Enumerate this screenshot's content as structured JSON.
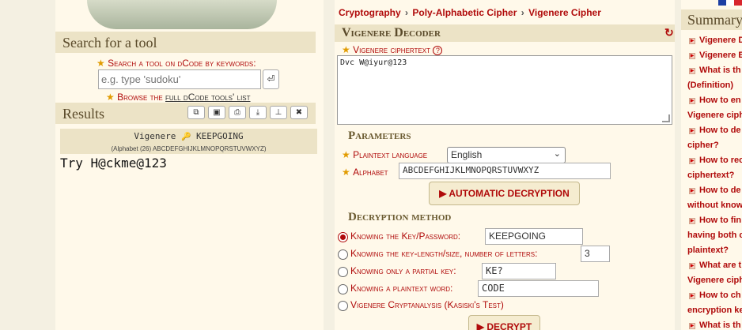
{
  "search": {
    "heading": "Search for a tool",
    "label": "Search a tool on dCode by keywords:",
    "placeholder": "e.g. type 'sudoku'",
    "go_symbol": "⏎",
    "browse_prefix": "Browse the ",
    "browse_link": "full dCode tools' list"
  },
  "results": {
    "heading": "Results",
    "icons": [
      "copy-icon",
      "screenshot-icon",
      "print-icon",
      "download-icon",
      "pin-icon",
      "close-icon"
    ],
    "cipher_name": "Vigenere",
    "key_symbol": "🔑",
    "key": "KEEPGOING",
    "alphabet_note": "(Alphabet (26) ABCDEFGHIJKLMNOPQRSTUVWXYZ)",
    "output": "Try H@ckme@123"
  },
  "breadcrumb": {
    "items": [
      "Cryptography",
      "Poly-Alphabetic Cipher",
      "Vigenere Cipher"
    ],
    "separator": "›"
  },
  "decoder": {
    "title": "Vigenere Decoder",
    "refresh_symbol": "↻",
    "ciphertext_label": "Vigenere ciphertext",
    "ciphertext": "Dvc W@iyur@123",
    "parameters_heading": "Parameters",
    "language_label": "Plaintext language",
    "language": "English",
    "alphabet_label": "Alphabet",
    "alphabet": "ABCDEFGHIJKLMNOPQRSTUVWXYZ",
    "auto_button": "▶ AUTOMATIC DECRYPTION",
    "method_heading": "Decryption method",
    "methods": [
      {
        "label": "Knowing the Key/Password:",
        "value": "KEEPGOING",
        "selected": true
      },
      {
        "label": "Knowing the key-length/size, number of letters:",
        "value": "3",
        "selected": false
      },
      {
        "label": "Knowing only a partial key:",
        "value": "KE?",
        "selected": false
      },
      {
        "label": "Knowing a plaintext word:",
        "value": "CODE",
        "selected": false
      },
      {
        "label": "Vigenere Cryptanalysis (Kasiski's Test)",
        "selected": false
      }
    ],
    "decrypt_button": "▶ DECRYPT"
  },
  "summary": {
    "heading": "Summary",
    "lines": [
      "Vigenere D",
      "Vigenere E",
      "What is th",
      "(Definition)",
      "How to en",
      "Vigenere ciph",
      "How to de",
      "cipher?",
      "How to rec",
      "ciphertext?",
      "How to de",
      "without know",
      "How to fin",
      "having both c",
      "plaintext?",
      "What are t",
      "Vigenere ciph",
      "How to ch",
      "encryption ke",
      "What is th"
    ]
  },
  "colors": {
    "accent": "#b00a0a",
    "star": "#e19b00",
    "panel": "#fff9ea",
    "header": "#ece3c6"
  }
}
